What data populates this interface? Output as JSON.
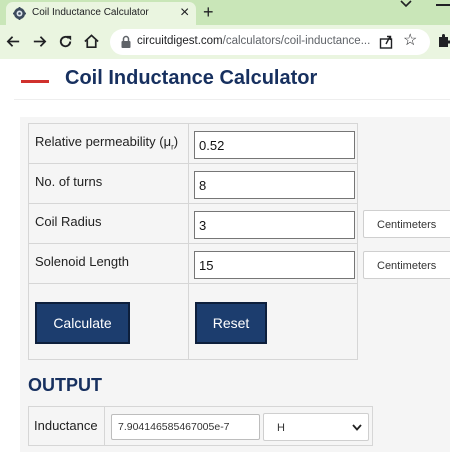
{
  "browser": {
    "tab_title": "Coil Inductance Calculator",
    "tab_close": "×",
    "new_tab": "+",
    "url_host": "circuitdigest.com",
    "url_path": "/calculators/coil-inductance...",
    "star": "☆"
  },
  "page": {
    "title": "Coil Inductance Calculator",
    "accent_color": "#d0312d",
    "title_color": "#17305f"
  },
  "form": {
    "rows": [
      {
        "label": "Relative permeability (μ",
        "label_sub": "r",
        "label_end": ")",
        "value": "0.52"
      },
      {
        "label": "No. of turns",
        "value": "8"
      },
      {
        "label": "Coil Radius",
        "value": "3",
        "unit": "Centimeters"
      },
      {
        "label": "Solenoid Length",
        "value": "15",
        "unit": "Centimeters"
      }
    ],
    "calculate_label": "Calculate",
    "reset_label": "Reset",
    "button_color": "#1c3d6e"
  },
  "output": {
    "title": "OUTPUT",
    "label": "Inductance",
    "value": "7.904146585467005e-7",
    "unit": "H"
  }
}
